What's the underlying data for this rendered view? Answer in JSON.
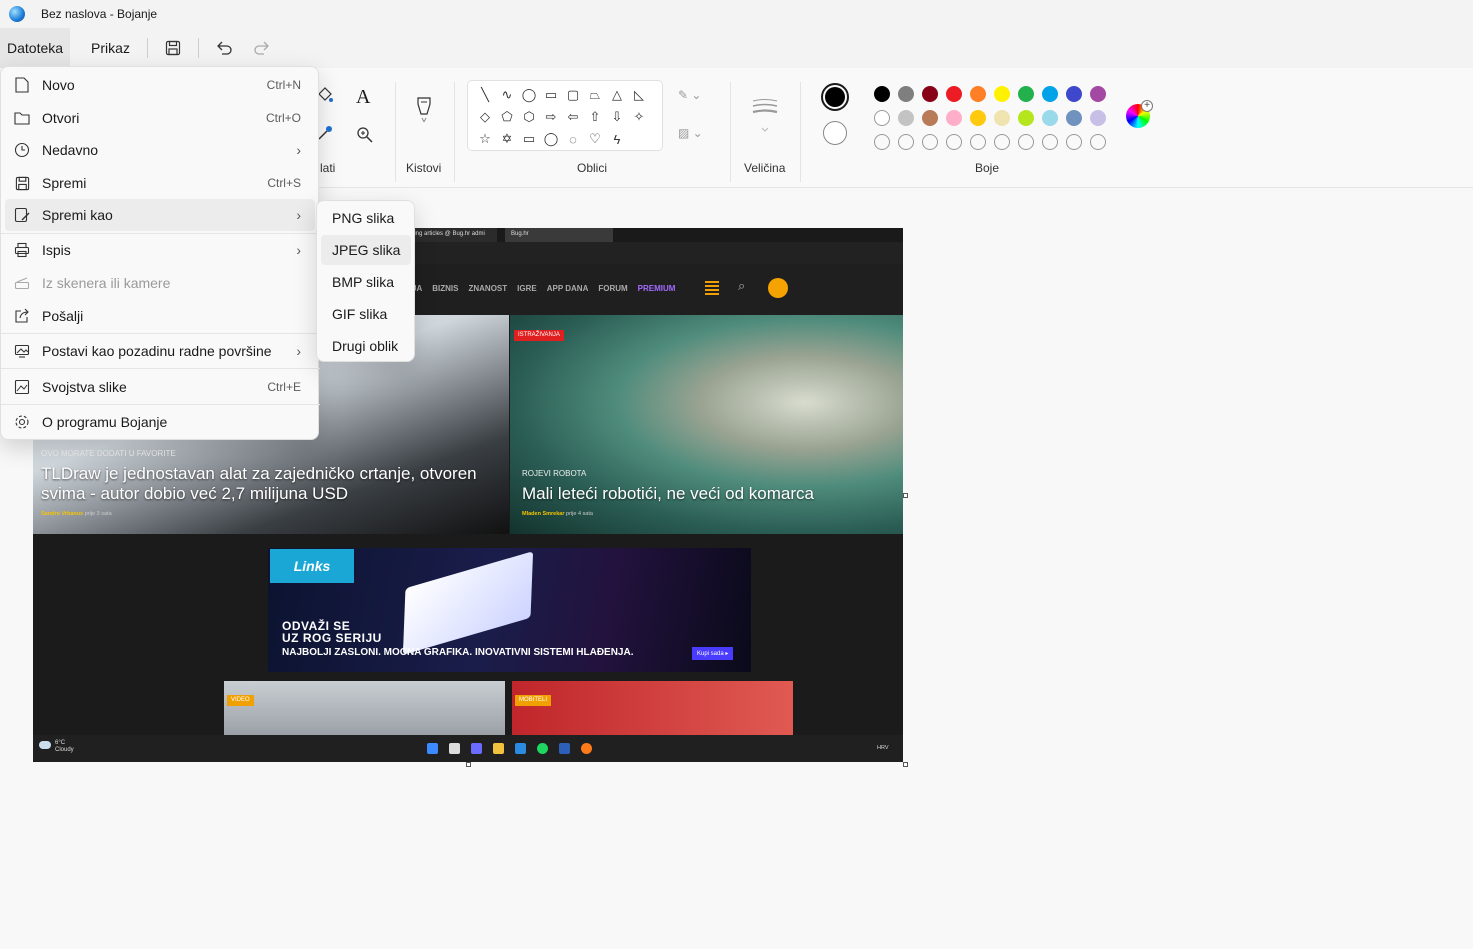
{
  "window": {
    "title": "Bez naslova - Bojanje"
  },
  "menubar": {
    "file": "Datoteka",
    "view": "Prikaz"
  },
  "ribbon": {
    "tools_partial": "lati",
    "brushes": "Kistovi",
    "shapes": "Oblici",
    "size": "Veličina",
    "colors": "Boje",
    "palette_row1": [
      "#000000",
      "#7f7f7f",
      "#880015",
      "#ed1c24",
      "#ff7f27",
      "#fff200",
      "#22b14c",
      "#00a2e8",
      "#3f48cc",
      "#a349a4"
    ],
    "palette_row2": [
      "#ffffff",
      "#c3c3c3",
      "#b97a57",
      "#ffaec9",
      "#ffc90e",
      "#efe4b0",
      "#b5e61d",
      "#99d9ea",
      "#7092be",
      "#c8bfe7"
    ],
    "primary_color": "#000000",
    "secondary_color": "#ffffff"
  },
  "file_menu": {
    "items": [
      {
        "label": "Novo",
        "shortcut": "Ctrl+N"
      },
      {
        "label": "Otvori",
        "shortcut": "Ctrl+O"
      },
      {
        "label": "Nedavno",
        "shortcut": ""
      },
      {
        "label": "Spremi",
        "shortcut": "Ctrl+S"
      },
      {
        "label": "Spremi kao",
        "shortcut": ""
      },
      {
        "label": "Ispis",
        "shortcut": ""
      },
      {
        "label": "Iz skenera ili kamere",
        "shortcut": ""
      },
      {
        "label": "Pošalji",
        "shortcut": ""
      },
      {
        "label": "Postavi kao pozadinu radne površine",
        "shortcut": ""
      },
      {
        "label": "Svojstva slike",
        "shortcut": "Ctrl+E"
      },
      {
        "label": "O programu Bojanje",
        "shortcut": ""
      }
    ]
  },
  "save_as_menu": {
    "items": [
      "PNG slika",
      "JPEG slika",
      "BMP slika",
      "GIF slika",
      "Drugi oblik"
    ]
  },
  "canvas_image": {
    "browser_tabs": [
      "ding articles @ Bug.hr admi",
      "Bug.hr"
    ],
    "nav": [
      "JA",
      "BIZNIS",
      "ZNANOST",
      "IGRE",
      "APP DANA",
      "FORUM",
      "PREMIUM"
    ],
    "left_story": {
      "kicker": "OVO MORATE DODATI U FAVORITE",
      "title": "TLDraw je jednostavan alat za zajedničko crtanje, otvoren svima - autor dobio već 2,7 milijuna USD",
      "author": "Sandro Vrbanus",
      "time": "prije 3 sata"
    },
    "right_story": {
      "badge": "ISTRAŽIVANJA",
      "kicker": "ROJEVI ROBOTA",
      "title": "Mali leteći robotići, ne veći od komarca",
      "author": "Mladen Smrekar",
      "time": "prije 4 sata"
    },
    "ad": {
      "logo": "Links",
      "line1": "ODVAŽI SE",
      "line2": "UZ ROG SERIJU",
      "tagline": "NAJBOLJI ZASLONI. MOĆNA GRAFIKA. INOVATIVNI SISTEMI HLAĐENJA.",
      "cta": "Kupi sada ▸"
    },
    "tile_tags": [
      "VIDEO",
      "MOBITELI"
    ],
    "taskbar": {
      "temp": "6°C",
      "weather": "Cloudy",
      "lang": "HRV"
    }
  }
}
